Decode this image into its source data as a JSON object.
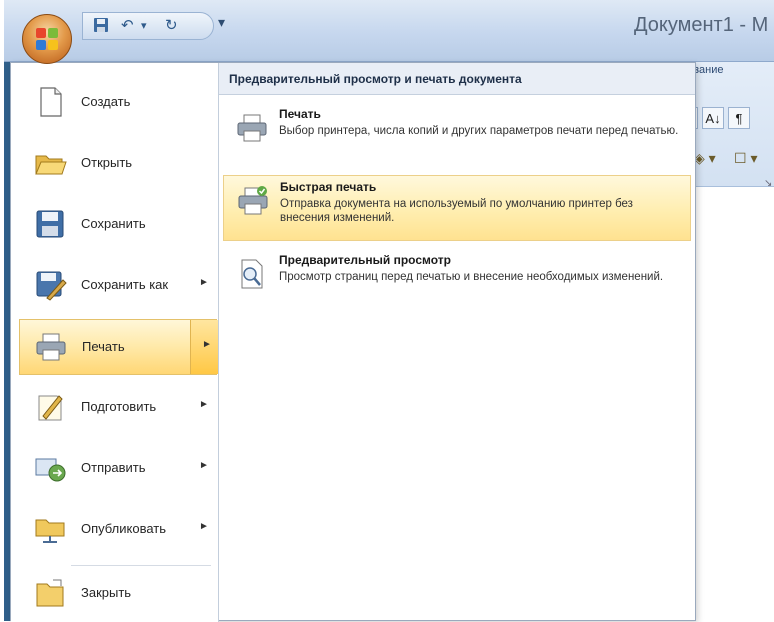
{
  "window": {
    "title": "Документ1 - М"
  },
  "ribbon": {
    "tab_partial": "зание",
    "btn1": "↕",
    "btn2": "A↓",
    "btn3": "¶"
  },
  "menu": {
    "items": [
      {
        "label": "Создать",
        "has_arrow": false,
        "icon": "new-document-icon"
      },
      {
        "label": "Открыть",
        "has_arrow": false,
        "icon": "open-folder-icon"
      },
      {
        "label": "Сохранить",
        "has_arrow": false,
        "icon": "save-icon"
      },
      {
        "label": "Сохранить как",
        "has_arrow": true,
        "icon": "save-as-icon"
      },
      {
        "label": "Печать",
        "has_arrow": true,
        "icon": "printer-icon"
      },
      {
        "label": "Подготовить",
        "has_arrow": true,
        "icon": "prepare-icon"
      },
      {
        "label": "Отправить",
        "has_arrow": true,
        "icon": "send-icon"
      },
      {
        "label": "Опубликовать",
        "has_arrow": true,
        "icon": "publish-icon"
      },
      {
        "label": "Закрыть",
        "has_arrow": false,
        "icon": "close-folder-icon"
      }
    ]
  },
  "submenu": {
    "title": "Предварительный просмотр и печать документа",
    "items": [
      {
        "title": "Печать",
        "description": "Выбор принтера, числа копий и других параметров печати перед печатью.",
        "icon": "printer-icon"
      },
      {
        "title": "Быстрая печать",
        "description": "Отправка документа на используемый по умолчанию принтер без внесения изменений.",
        "icon": "quick-print-icon"
      },
      {
        "title": "Предварительный просмотр",
        "description": "Просмотр страниц перед печатью и внесение необходимых изменений.",
        "icon": "print-preview-icon"
      }
    ]
  },
  "colors": {
    "active_highlight": "#ffd775",
    "title_bar": "#c6d7ee"
  }
}
